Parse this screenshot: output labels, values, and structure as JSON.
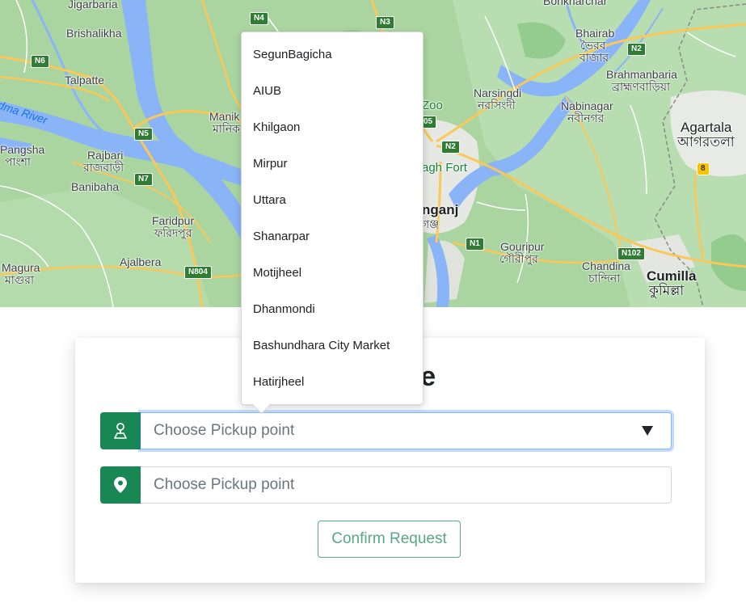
{
  "map": {
    "labels": [
      {
        "text": "Jigarbaria",
        "cls": ""
      },
      {
        "text": "Brishalikha",
        "cls": ""
      },
      {
        "text": "Talpatte",
        "cls": ""
      },
      {
        "text": "Manik",
        "cls": ""
      },
      {
        "text": "মানিক",
        "cls": ""
      },
      {
        "text": "Pangsha",
        "cls": ""
      },
      {
        "text": "পাংশা",
        "cls": ""
      },
      {
        "text": "Rajbari",
        "cls": ""
      },
      {
        "text": "রাজবাড়ী",
        "cls": ""
      },
      {
        "text": "Banibaha",
        "cls": ""
      },
      {
        "text": "Faridpur",
        "cls": ""
      },
      {
        "text": "ফরিদপুর",
        "cls": ""
      },
      {
        "text": "Magura",
        "cls": ""
      },
      {
        "text": "মাগুরা",
        "cls": ""
      },
      {
        "text": "Ajalbera",
        "cls": ""
      },
      {
        "text": "dma River",
        "cls": "water"
      },
      {
        "text": "Zoo",
        "cls": "park"
      },
      {
        "text": "agh Fort",
        "cls": "park"
      },
      {
        "text": "nganj",
        "cls": "big"
      },
      {
        "text": "গঞ্জ",
        "cls": ""
      },
      {
        "text": "Bhairab",
        "cls": ""
      },
      {
        "text": "ভৈরব",
        "cls": ""
      },
      {
        "text": "বাজার",
        "cls": ""
      },
      {
        "text": "Narsingdi",
        "cls": ""
      },
      {
        "text": "নরসিংদী",
        "cls": ""
      },
      {
        "text": "Brahmanbaria",
        "cls": ""
      },
      {
        "text": "ব্রাহ্মণবাড়িয়া",
        "cls": ""
      },
      {
        "text": "Nabinagar",
        "cls": ""
      },
      {
        "text": "নবীনগর",
        "cls": ""
      },
      {
        "text": "Agartala",
        "cls": "big"
      },
      {
        "text": "আগরতলা",
        "cls": "big"
      },
      {
        "text": "Gouripur",
        "cls": ""
      },
      {
        "text": "গৌরীপুর",
        "cls": ""
      },
      {
        "text": "Chandina",
        "cls": ""
      },
      {
        "text": "চান্দিনা",
        "cls": ""
      },
      {
        "text": "Cumilla",
        "cls": "big"
      },
      {
        "text": "কুমিল্লা",
        "cls": "big"
      },
      {
        "text": "Bonkharchar",
        "cls": ""
      }
    ],
    "shields": [
      {
        "text": "N4",
        "cls": ""
      },
      {
        "text": "N3",
        "cls": ""
      },
      {
        "text": "N6",
        "cls": ""
      },
      {
        "text": "N5",
        "cls": ""
      },
      {
        "text": "N7",
        "cls": ""
      },
      {
        "text": "N804",
        "cls": ""
      },
      {
        "text": "N2",
        "cls": ""
      },
      {
        "text": "N2",
        "cls": ""
      },
      {
        "text": "05",
        "cls": ""
      },
      {
        "text": "N1",
        "cls": ""
      },
      {
        "text": "N102",
        "cls": ""
      },
      {
        "text": "8",
        "cls": "yellow"
      }
    ]
  },
  "card": {
    "title": "r a ride",
    "pickup_placeholder": "Choose Pickup point",
    "dropoff_placeholder": "Choose Pickup point",
    "confirm_label": "Confirm Request"
  },
  "dropdown": {
    "options": [
      "SegunBagicha",
      "AIUB",
      "Khilgaon",
      "Mirpur",
      "Uttara",
      "Shanarpar",
      "Motijheel",
      "Dhanmondi",
      "Bashundhara City Market",
      "Hatirjheel"
    ]
  },
  "colors": {
    "accent": "#198754",
    "focus_border": "#86b7fe",
    "map_green": "#a8d8a2",
    "water": "#8ab4f8"
  }
}
